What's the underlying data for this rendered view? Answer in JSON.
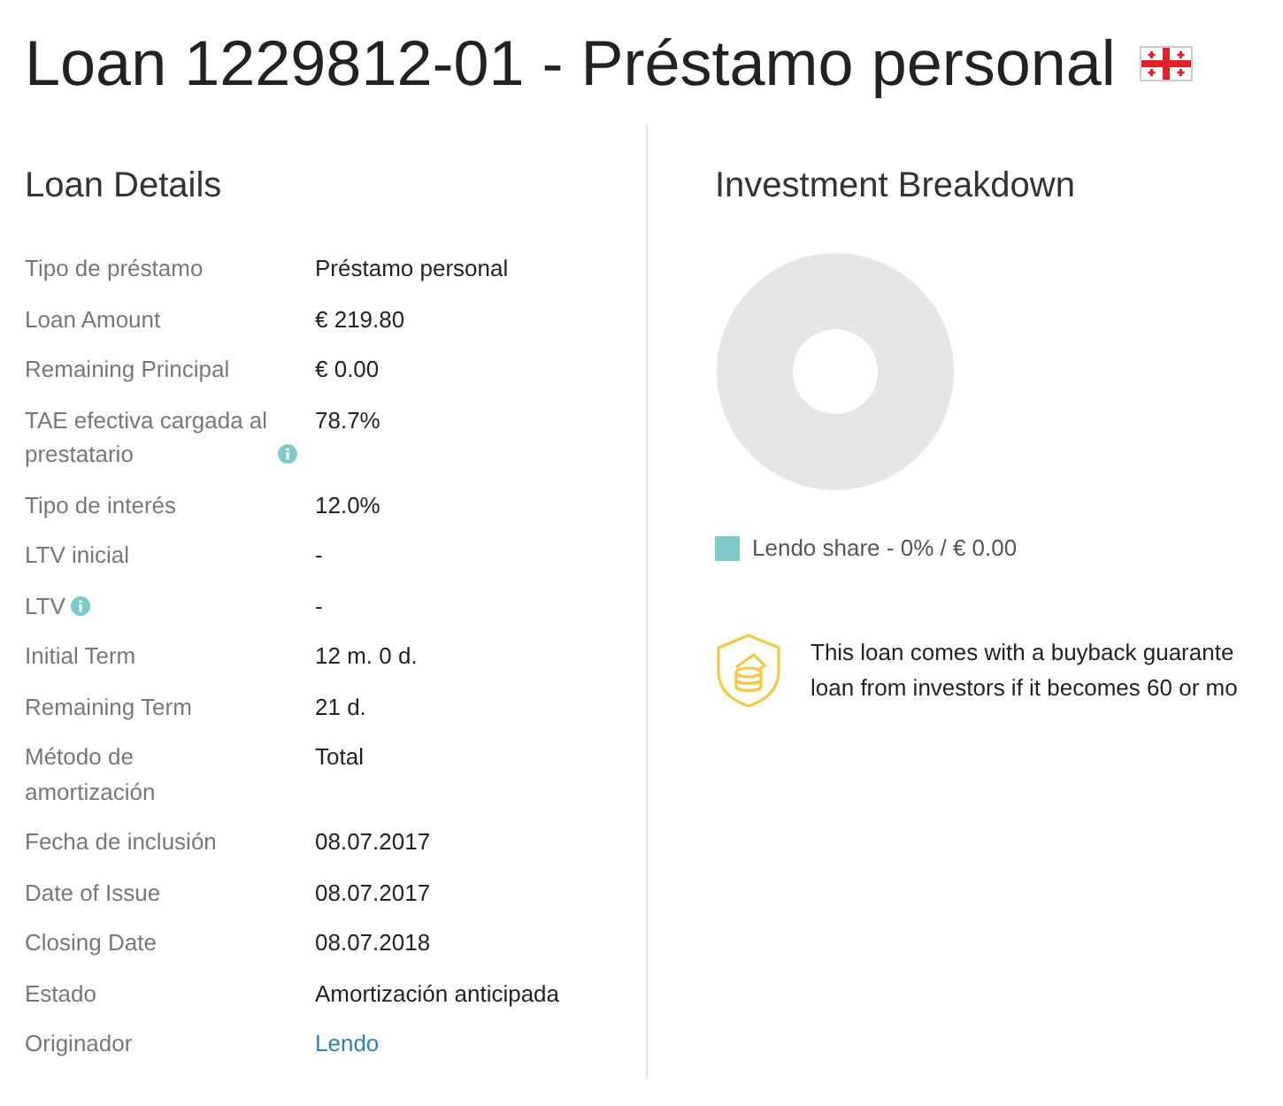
{
  "title": "Loan 1229812-01 - Préstamo personal",
  "details": {
    "heading": "Loan Details",
    "rows": [
      {
        "label": "Tipo de préstamo",
        "value": "Préstamo personal"
      },
      {
        "label": "Loan Amount",
        "value": "€ 219.80"
      },
      {
        "label": "Remaining Principal",
        "value": "€ 0.00"
      },
      {
        "label": "TAE efectiva cargada al prestatario",
        "value": "78.7%",
        "info": true
      },
      {
        "label": "Tipo de interés",
        "value": "12.0%"
      },
      {
        "label": "LTV inicial",
        "value": "-"
      },
      {
        "label": "LTV",
        "value": "-",
        "info": true
      },
      {
        "label": "Initial Term",
        "value": "12 m. 0 d."
      },
      {
        "label": "Remaining Term",
        "value": "21 d."
      },
      {
        "label": "Método de amortización",
        "value": "Total"
      },
      {
        "label": "Fecha de inclusión",
        "value": "08.07.2017"
      },
      {
        "label": "Date of Issue",
        "value": "08.07.2017"
      },
      {
        "label": "Closing Date",
        "value": "08.07.2018"
      },
      {
        "label": "Estado",
        "value": "Amortización anticipada"
      },
      {
        "label": "Originador",
        "value": "Lendo",
        "kind": "link"
      }
    ]
  },
  "breakdown": {
    "heading": "Investment Breakdown",
    "legend": [
      {
        "label": "Lendo share - 0% / € 0.00",
        "color": "#7ecac8"
      }
    ],
    "guarantee": [
      "This loan comes with a buyback guarante",
      "loan from investors if it becomes 60 or mo"
    ]
  }
}
